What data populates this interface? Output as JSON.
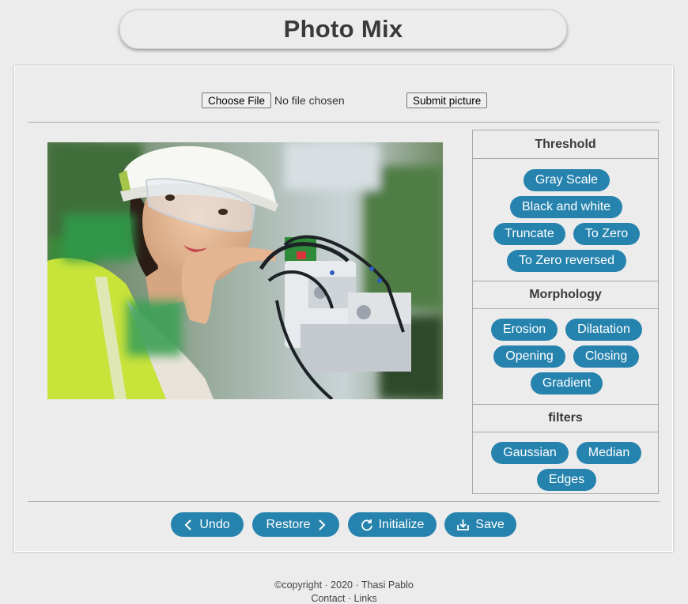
{
  "app": {
    "title": "Photo Mix"
  },
  "upload": {
    "choose_label": "Choose File",
    "file_status": "No file chosen",
    "submit_label": "Submit picture"
  },
  "photo": {
    "alt": "Engineer with hard hat and safety glasses working on machinery"
  },
  "threshold": {
    "heading": "Threshold",
    "buttons": [
      "Gray Scale",
      "Black and white",
      "Truncate",
      "To Zero",
      "To Zero reversed"
    ]
  },
  "morphology": {
    "heading": "Morphology",
    "buttons": [
      "Erosion",
      "Dilatation",
      "Opening",
      "Closing",
      "Gradient"
    ]
  },
  "filters": {
    "heading": "filters",
    "buttons": [
      "Gaussian",
      "Median",
      "Edges"
    ]
  },
  "actions": {
    "undo": "Undo",
    "restore": "Restore",
    "initialize": "Initialize",
    "save": "Save"
  },
  "footer": {
    "copyright": "©copyright · 2020 · Thasi Pablo",
    "second_line": "Contact · Links"
  },
  "colors": {
    "accent": "#2683ae",
    "background": "#ececec"
  }
}
